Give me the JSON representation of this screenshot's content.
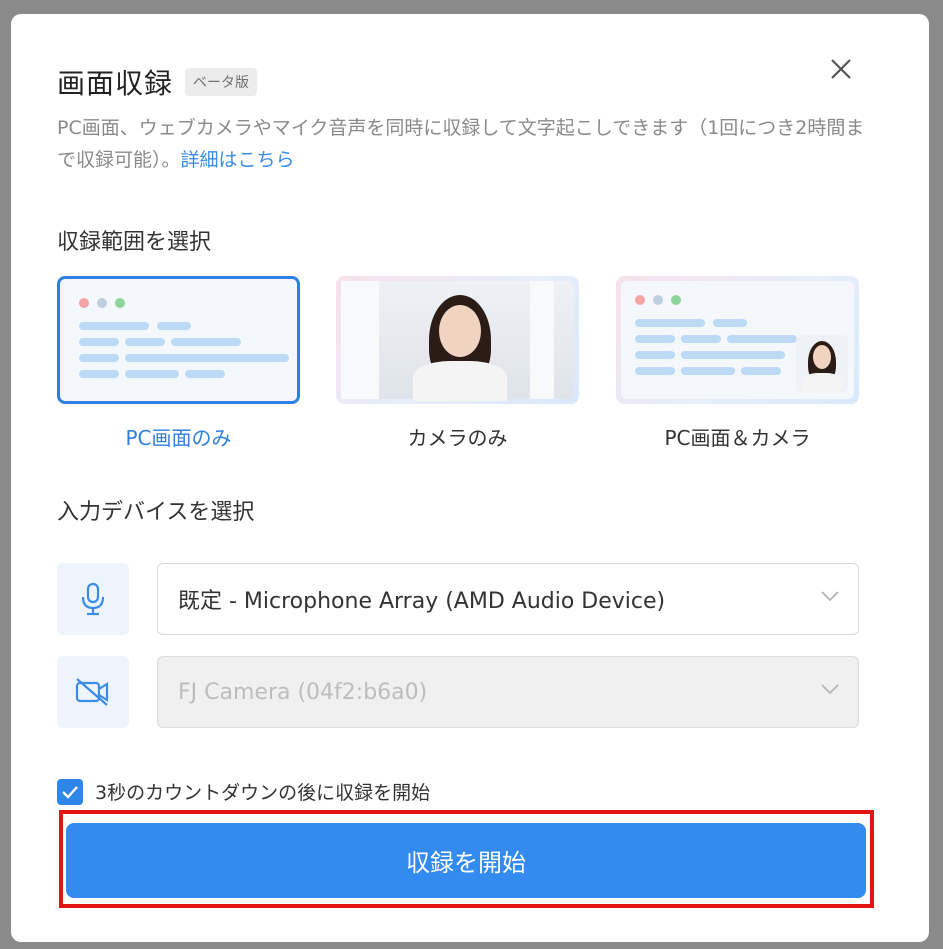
{
  "dialog": {
    "title": "画面収録",
    "badge": "ベータ版",
    "description": "PC画面、ウェブカメラやマイク音声を同時に収録して文字起こしできます（1回につき2時間まで収録可能）。",
    "description_link": "詳細はこちら"
  },
  "range_section": {
    "label": "収録範囲を選択",
    "options": [
      {
        "label": "PC画面のみ",
        "selected": true
      },
      {
        "label": "カメラのみ",
        "selected": false
      },
      {
        "label": "PC画面＆カメラ",
        "selected": false
      }
    ]
  },
  "device_section": {
    "label": "入力デバイスを選択",
    "microphone": {
      "icon": "microphone-icon",
      "value": "既定 - Microphone Array (AMD Audio Device)"
    },
    "camera": {
      "icon": "camera-off-icon",
      "value": "FJ Camera (04f2:b6a0)",
      "disabled": true
    }
  },
  "countdown": {
    "label": "3秒のカウントダウンの後に収録を開始",
    "checked": true
  },
  "start_button": "収録を開始",
  "colors": {
    "accent": "#338bef",
    "highlight": "#e31414"
  }
}
